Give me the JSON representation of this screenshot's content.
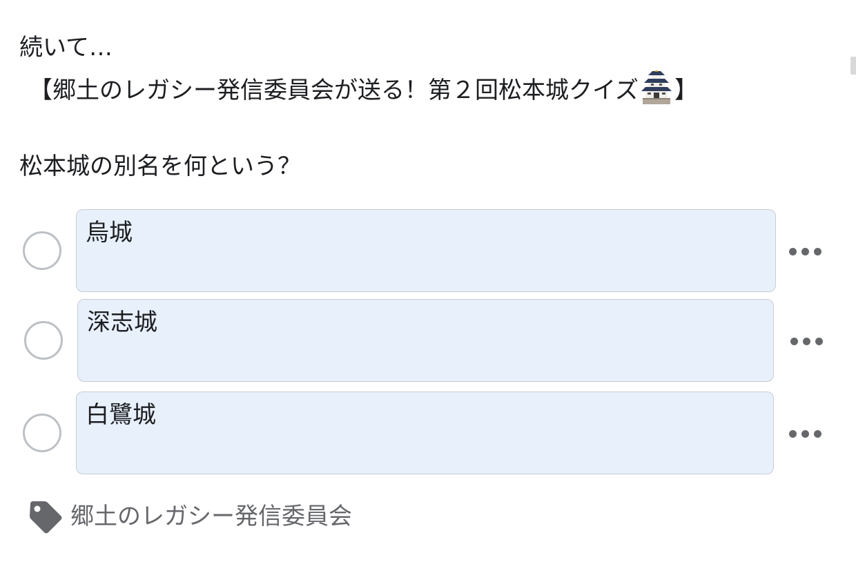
{
  "post": {
    "intro": "続いて…",
    "title_before_icon": "【郷土のレガシー発信委員会が送る！第２回松本城クイズ",
    "title_icon": "japanese-castle-icon",
    "title_after_icon": "】",
    "question": "松本城の別名を何という？"
  },
  "poll": {
    "options": [
      {
        "label": "烏城",
        "selected": false
      },
      {
        "label": "深志城",
        "selected": false
      },
      {
        "label": "白鷺城",
        "selected": false
      }
    ]
  },
  "tag": {
    "icon": "tag-icon",
    "label": "郷土のレガシー発信委員会"
  },
  "colors": {
    "option_background": "#e8f0fc",
    "radio_border": "#bcc0c4",
    "muted_text": "#65676b"
  }
}
